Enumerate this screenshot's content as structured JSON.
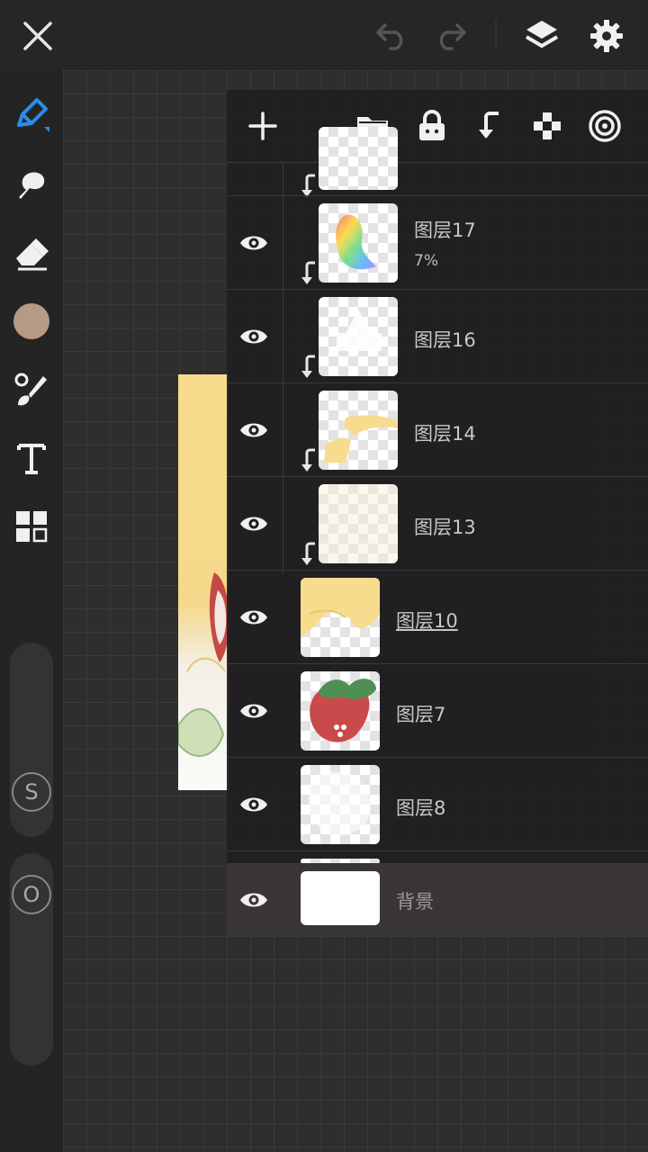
{
  "app": {
    "topbar": {
      "close_icon": "close-icon",
      "undo_icon": "undo-icon",
      "redo_icon": "redo-icon",
      "layers_icon": "layers-icon",
      "settings_icon": "gear-icon"
    },
    "tools": [
      "pen-tool-icon",
      "smudge-icon",
      "eraser-icon",
      "color-swatch",
      "brush-icon",
      "text-icon",
      "more-tools-icon"
    ],
    "current_color": "#b59a86",
    "accent_color": "#2a8de8",
    "sliders": {
      "size_label": "S",
      "opacity_label": "O"
    }
  },
  "layers_panel": {
    "header_icons": [
      "add-layer-icon",
      "folder-icon",
      "lock-icon",
      "clip-down-icon",
      "alpha-lock-icon",
      "blend-icon"
    ],
    "layers": [
      {
        "name": "图层17",
        "opacity": "7%",
        "clipped": true
      },
      {
        "name": "图层16",
        "clipped": true
      },
      {
        "name": "图层14",
        "clipped": true
      },
      {
        "name": "图层13",
        "clipped": true
      },
      {
        "name": "图层10",
        "clipped": false,
        "selected": true
      },
      {
        "name": "图层7",
        "clipped": false
      },
      {
        "name": "图层8",
        "clipped": false
      },
      {
        "name": "背景",
        "clipped": false
      }
    ]
  }
}
